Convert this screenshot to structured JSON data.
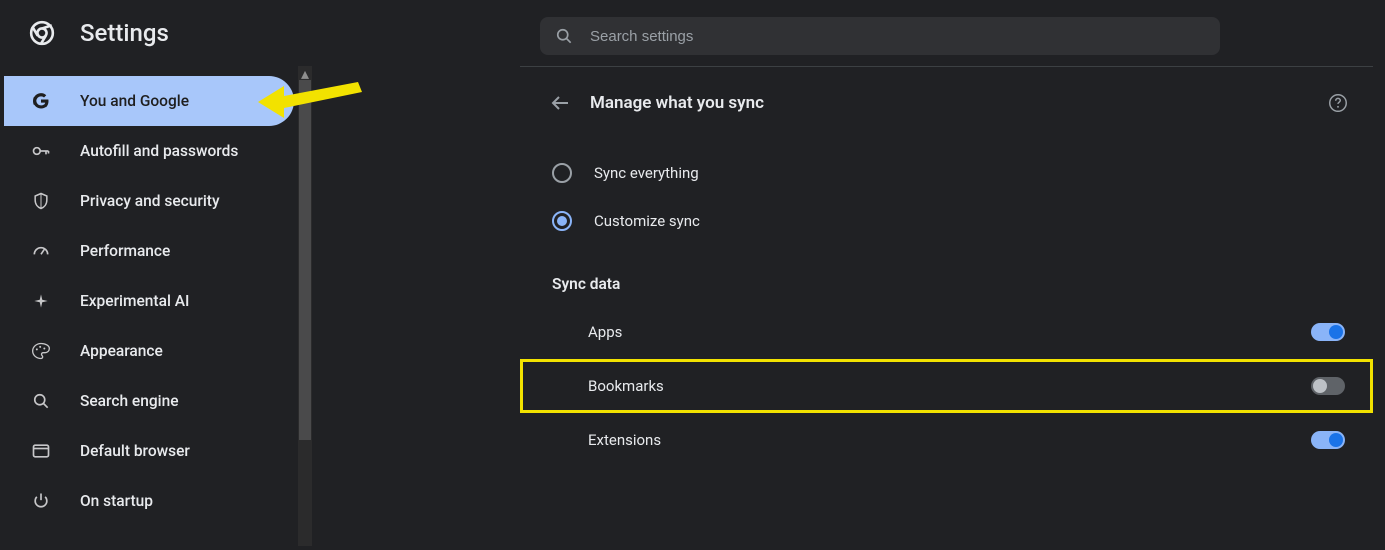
{
  "header": {
    "title": "Settings",
    "search_placeholder": "Search settings"
  },
  "sidebar": {
    "items": [
      {
        "label": "You and Google",
        "selected": true
      },
      {
        "label": "Autofill and passwords",
        "selected": false
      },
      {
        "label": "Privacy and security",
        "selected": false
      },
      {
        "label": "Performance",
        "selected": false
      },
      {
        "label": "Experimental AI",
        "selected": false
      },
      {
        "label": "Appearance",
        "selected": false
      },
      {
        "label": "Search engine",
        "selected": false
      },
      {
        "label": "Default browser",
        "selected": false
      },
      {
        "label": "On startup",
        "selected": false
      }
    ]
  },
  "content": {
    "title": "Manage what you sync",
    "radio_options": [
      {
        "label": "Sync everything",
        "selected": false
      },
      {
        "label": "Customize sync",
        "selected": true
      }
    ],
    "sync_section_title": "Sync data",
    "sync_items": [
      {
        "label": "Apps",
        "on": true,
        "highlight": false
      },
      {
        "label": "Bookmarks",
        "on": false,
        "highlight": true
      },
      {
        "label": "Extensions",
        "on": true,
        "highlight": false
      }
    ]
  },
  "annotations": {
    "arrow_color": "#f2e200",
    "accent_color": "#8ab4f8"
  }
}
